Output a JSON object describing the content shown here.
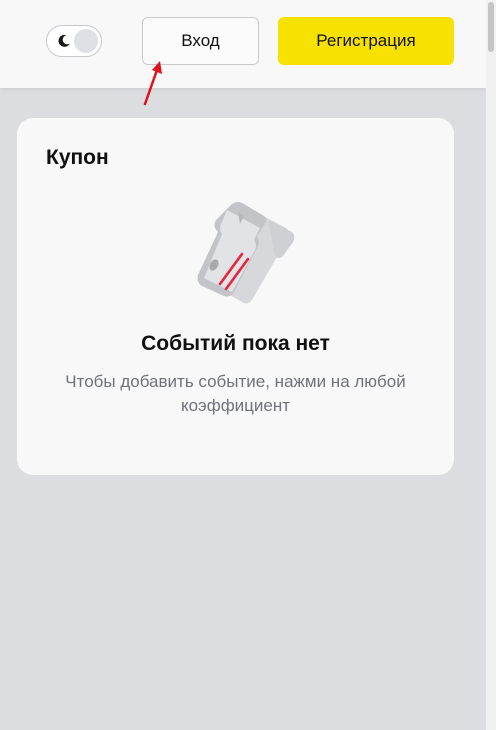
{
  "header": {
    "theme_toggle": {
      "icon": "moon-icon",
      "state": "light"
    },
    "login_label": "Вход",
    "register_label": "Регистрация",
    "register_color": "#f7e100"
  },
  "coupon": {
    "title": "Купон",
    "illustration_icon": "coupon-ticket-icon",
    "empty_title": "Событий пока нет",
    "empty_hint": "Чтобы добавить событие, нажми на любой коэффициент"
  },
  "annotation": {
    "color": "#e0131b"
  }
}
